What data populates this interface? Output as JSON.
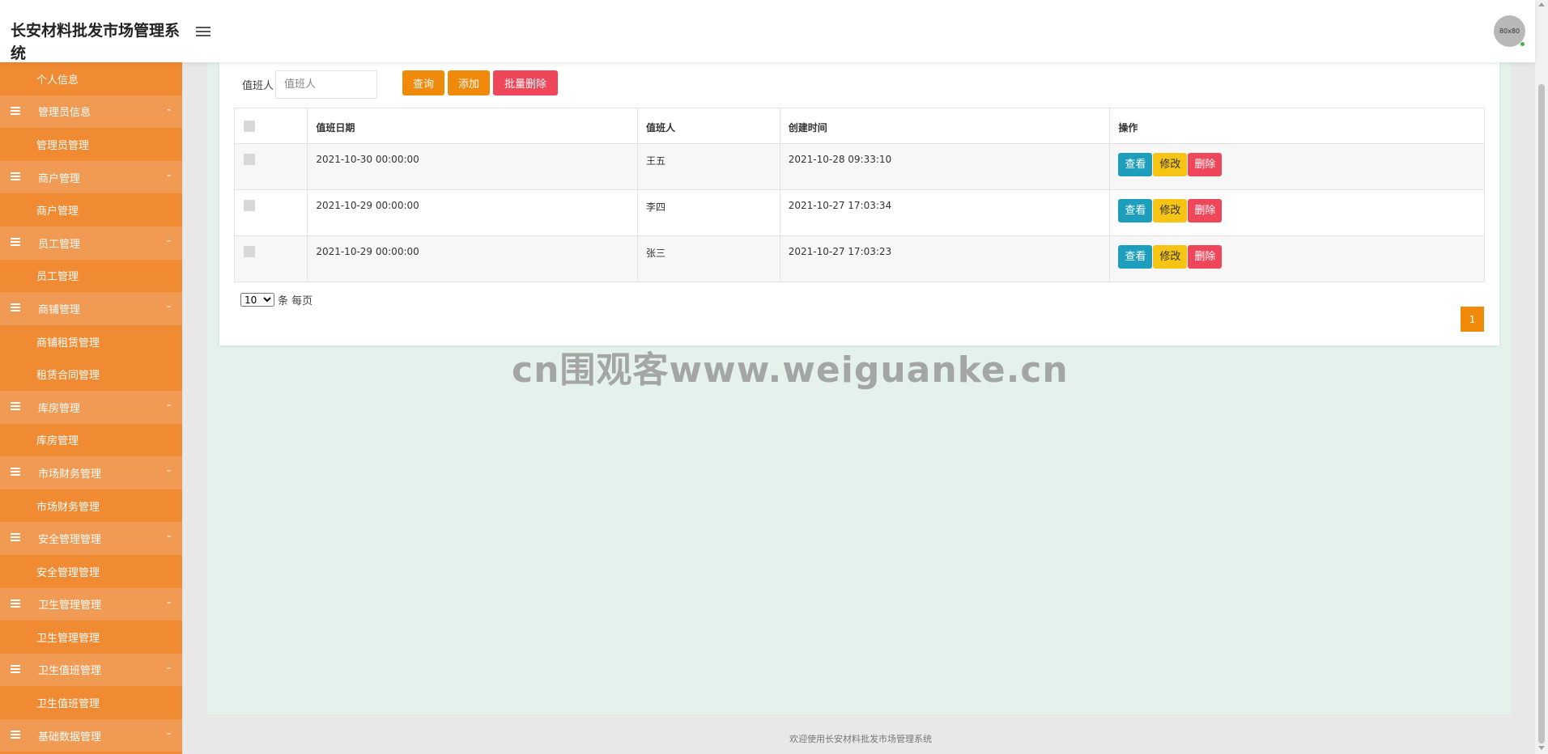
{
  "header": {
    "title": "长安材料批发市场管理系统",
    "avatar_text": "80x80"
  },
  "sidebar": {
    "items": [
      {
        "type": "sub",
        "label": "个人信息"
      },
      {
        "type": "group",
        "label": "管理员信息",
        "toggle": "-"
      },
      {
        "type": "sub",
        "label": "管理员管理"
      },
      {
        "type": "group",
        "label": "商户管理",
        "toggle": "-"
      },
      {
        "type": "sub",
        "label": "商户管理"
      },
      {
        "type": "group",
        "label": "员工管理",
        "toggle": "-"
      },
      {
        "type": "sub",
        "label": "员工管理"
      },
      {
        "type": "group",
        "label": "商铺管理",
        "toggle": "-"
      },
      {
        "type": "sub",
        "label": "商铺租赁管理"
      },
      {
        "type": "sub",
        "label": "租赁合同管理"
      },
      {
        "type": "group",
        "label": "库房管理",
        "toggle": "-"
      },
      {
        "type": "sub",
        "label": "库房管理"
      },
      {
        "type": "group",
        "label": "市场财务管理",
        "toggle": "-"
      },
      {
        "type": "sub",
        "label": "市场财务管理"
      },
      {
        "type": "group",
        "label": "安全管理管理",
        "toggle": "-"
      },
      {
        "type": "sub",
        "label": "安全管理管理"
      },
      {
        "type": "group",
        "label": "卫生管理管理",
        "toggle": "-"
      },
      {
        "type": "sub",
        "label": "卫生管理管理"
      },
      {
        "type": "group",
        "label": "卫生值班管理",
        "toggle": "-"
      },
      {
        "type": "sub",
        "label": "卫生值班管理"
      },
      {
        "type": "group",
        "label": "基础数据管理",
        "toggle": "-"
      }
    ]
  },
  "search": {
    "label": "值班人",
    "placeholder": "值班人",
    "query_label": "查询",
    "add_label": "添加",
    "batch_delete_label": "批量删除"
  },
  "table": {
    "columns": [
      "值班日期",
      "值班人",
      "创建时间",
      "操作"
    ],
    "rows": [
      {
        "date": "2021-10-30 00:00:00",
        "person": "王五",
        "created": "2021-10-28 09:33:10"
      },
      {
        "date": "2021-10-29 00:00:00",
        "person": "李四",
        "created": "2021-10-27 17:03:34"
      },
      {
        "date": "2021-10-29 00:00:00",
        "person": "张三",
        "created": "2021-10-27 17:03:23"
      }
    ],
    "actions": {
      "view": "查看",
      "edit": "修改",
      "delete": "删除"
    }
  },
  "pagination": {
    "page_size": "10",
    "page_size_suffix": "条 每页",
    "current_page": "1"
  },
  "watermark": "cn围观客www.weiguanke.cn",
  "footer": "欢迎使用长安材料批发市场管理系统",
  "colors": {
    "sidebar": "#f08a33",
    "sidebar_group": "#f09a53",
    "primary": "#f08a0a",
    "danger": "#f0465a",
    "info": "#1d9ebc",
    "warning": "#f5c414",
    "content_bg": "#e5f2ec"
  }
}
